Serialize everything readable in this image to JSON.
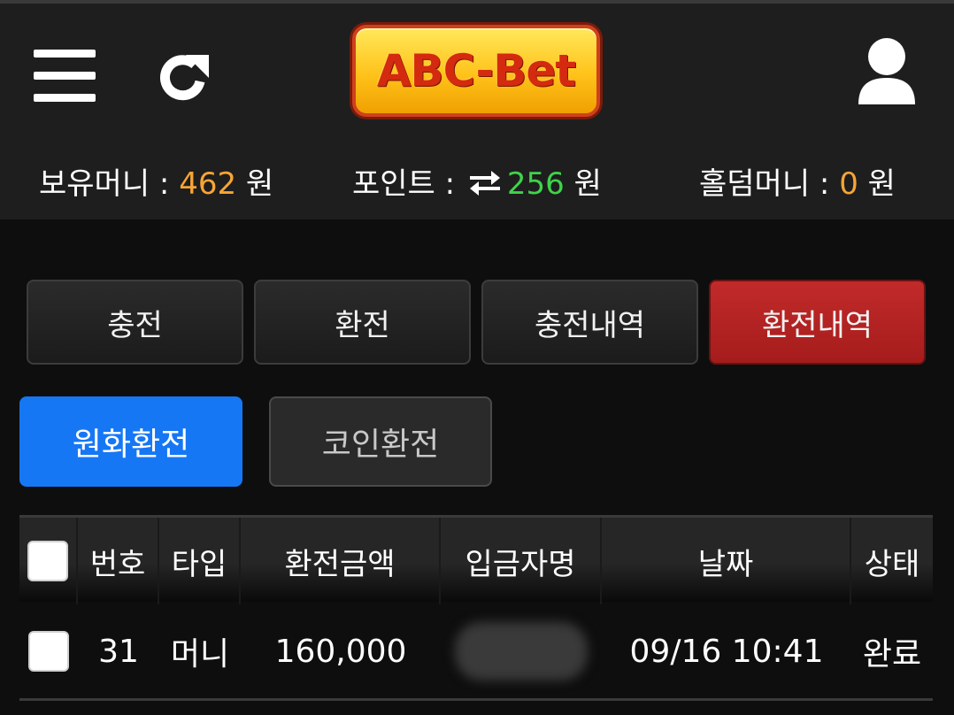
{
  "header": {
    "logo_text": "ABC-Bet",
    "icons": {
      "menu": "hamburger-icon",
      "refresh": "refresh-icon",
      "user": "user-icon"
    }
  },
  "balances": {
    "money_label": "보유머니 : ",
    "money_value": "462",
    "money_unit": " 원",
    "point_label": "포인트 : ",
    "point_value": "256",
    "point_unit": " 원",
    "hold_label": "홀덤머니 : ",
    "hold_value": "0",
    "hold_unit": " 원"
  },
  "tabs": [
    {
      "label": "충전",
      "active": false
    },
    {
      "label": "환전",
      "active": false
    },
    {
      "label": "충전내역",
      "active": false
    },
    {
      "label": "환전내역",
      "active": true
    }
  ],
  "subtabs": [
    {
      "label": "원화환전",
      "active": true
    },
    {
      "label": "코인환전",
      "active": false
    }
  ],
  "table": {
    "headers": [
      "번호",
      "타입",
      "환전금액",
      "입금자명",
      "날짜",
      "상태"
    ],
    "rows": [
      {
        "no": "31",
        "type": "머니",
        "amount": "160,000",
        "depositor": "",
        "date": "09/16 10:41",
        "status": "완료"
      }
    ]
  },
  "colors": {
    "accent_blue": "#1677f5",
    "active_red": "#b42222",
    "value_orange": "#f7a535",
    "value_green": "#3fd34a"
  }
}
